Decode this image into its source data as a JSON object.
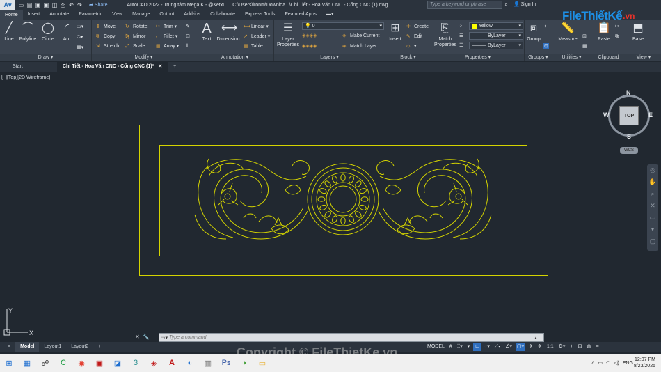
{
  "app": {
    "title": "AutoCAD 2022 - Trung tâm Mega K - @Ketxu",
    "file_path": "C:\\Users\\ironm\\Downloa...\\Chi Tiết - Hoa Văn CNC - Cổng CNC (1).dwg",
    "share_label": "Share",
    "search_placeholder": "Type a keyword or phrase",
    "sign_in": "Sign In"
  },
  "menu_tabs": [
    "Home",
    "Insert",
    "Annotate",
    "Parametric",
    "View",
    "Manage",
    "Output",
    "Add-ins",
    "Collaborate",
    "Express Tools",
    "Featured Apps"
  ],
  "ribbon": {
    "draw": {
      "title": "Draw ▾",
      "line": "Line",
      "polyline": "Polyline",
      "circle": "Circle",
      "arc": "Arc"
    },
    "modify": {
      "title": "Modify ▾",
      "move": "Move",
      "rotate": "Rotate",
      "trim": "Trim",
      "copy": "Copy",
      "mirror": "Mirror",
      "fillet": "Fillet",
      "stretch": "Stretch",
      "scale": "Scale",
      "array": "Array"
    },
    "annotation": {
      "title": "Annotation ▾",
      "text": "Text",
      "dimension": "Dimension",
      "linear": "Linear",
      "leader": "Leader",
      "table": "Table"
    },
    "layers": {
      "title": "Layers ▾",
      "layer_properties": "Layer Properties",
      "current_layer": "0",
      "make_current": "Make Current",
      "match_layer": "Match Layer"
    },
    "block": {
      "title": "Block ▾",
      "insert": "Insert",
      "create": "Create",
      "edit": "Edit"
    },
    "properties": {
      "title": "Properties ▾",
      "match_properties": "Match Properties",
      "color": "Yellow",
      "linetype": "ByLayer",
      "lineweight": "ByLayer"
    },
    "groups": {
      "title": "Groups ▾",
      "group": "Group"
    },
    "utilities": {
      "title": "Utilities ▾",
      "measure": "Measure"
    },
    "clipboard": {
      "title": "Clipboard",
      "paste": "Paste"
    },
    "view": {
      "title": "View ▾",
      "base": "Base"
    }
  },
  "doc_tabs": {
    "start": "Start",
    "active": "Chi Tiết - Hoa Văn CNC - Cổng CNC (1)*"
  },
  "viewport": {
    "label": "[−][Top][2D Wireframe]",
    "stroke_color": "#d4d400"
  },
  "viewcube": {
    "n": "N",
    "s": "S",
    "e": "E",
    "w": "W",
    "face": "TOP",
    "wcs": "WCS"
  },
  "ucs": {
    "x": "X",
    "y": "Y"
  },
  "command": {
    "placeholder": "Type a command"
  },
  "layout_tabs": [
    "Model",
    "Layout1",
    "Layout2"
  ],
  "status": {
    "model": "MODEL",
    "scale": "1:1"
  },
  "watermark": "Copyright © FileThietKe.vn",
  "brand": {
    "name": "FileThiếtKế",
    "tld": ".vn"
  },
  "taskbar": {
    "lang": "ENG",
    "time": "12:07 PM",
    "date": "8/23/2025"
  }
}
